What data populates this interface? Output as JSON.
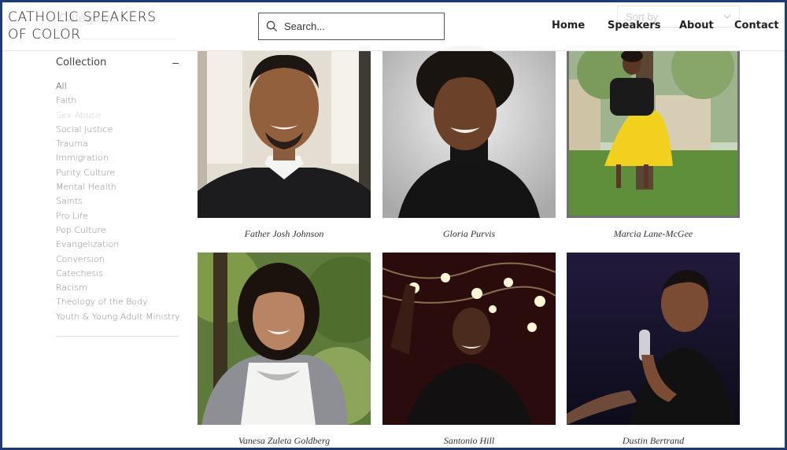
{
  "site": {
    "title_line1": "CATHOLIC SPEAKERS",
    "title_line2": "OF COLOR",
    "ghost_category": "Category"
  },
  "search": {
    "placeholder": "Search..."
  },
  "sort": {
    "label": "Sort by"
  },
  "nav": {
    "items": [
      {
        "label": "Home"
      },
      {
        "label": "Speakers"
      },
      {
        "label": "About"
      },
      {
        "label": "Contact"
      }
    ]
  },
  "sidebar": {
    "collection_title": "Collection",
    "toggle": "–",
    "items": [
      {
        "label": "All"
      },
      {
        "label": "Faith"
      },
      {
        "label": "Sex Abuse"
      },
      {
        "label": "Social Justice"
      },
      {
        "label": "Trauma"
      },
      {
        "label": "Immigration"
      },
      {
        "label": "Purity Culture"
      },
      {
        "label": "Mental Health"
      },
      {
        "label": "Saints"
      },
      {
        "label": "Pro Life"
      },
      {
        "label": "Pop Culture"
      },
      {
        "label": "Evangelization"
      },
      {
        "label": "Conversion"
      },
      {
        "label": "Catechesis"
      },
      {
        "label": "Racism"
      },
      {
        "label": "Theology of the Body"
      },
      {
        "label": "Youth & Young Adult Ministry"
      }
    ]
  },
  "speakers": [
    {
      "name": "Father Josh Johnson"
    },
    {
      "name": "Gloria Purvis"
    },
    {
      "name": "Marcia Lane-McGee"
    },
    {
      "name": "Vanesa Zuleta Goldberg"
    },
    {
      "name": "Santonio Hill"
    },
    {
      "name": "Dustin Bertrand"
    }
  ],
  "colors": {
    "frame": "#1f3a78",
    "text": "#222222",
    "muted": "#888888",
    "disabled": "#cfcfcf"
  }
}
